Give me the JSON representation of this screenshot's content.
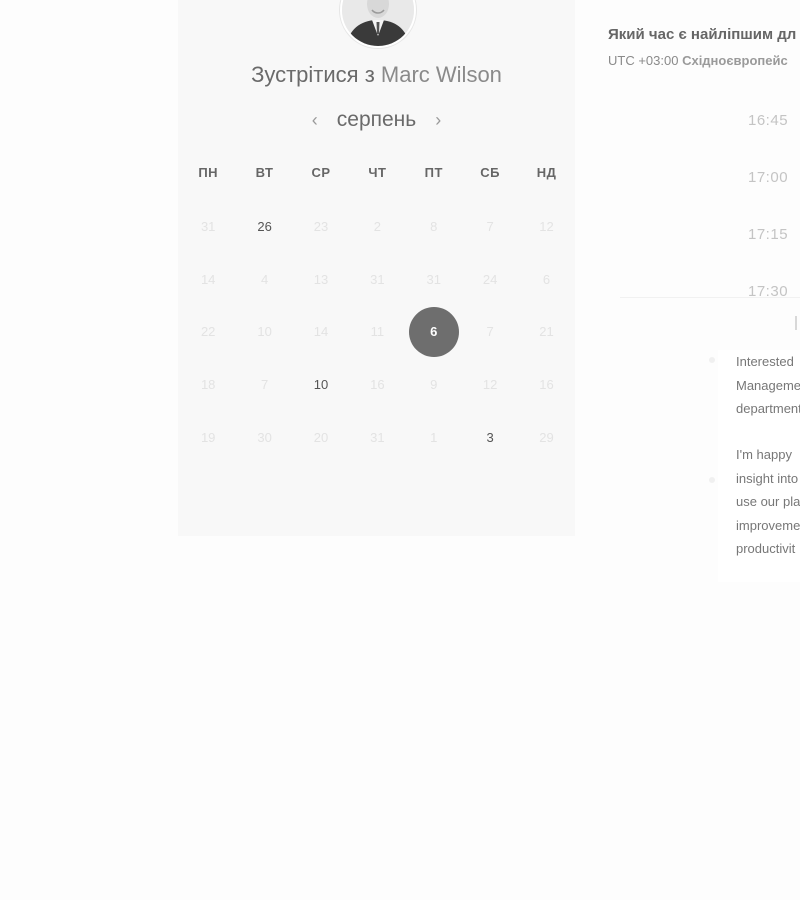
{
  "host": {
    "meet_prefix": "Зустрітися з",
    "name": "Marc Wilson"
  },
  "calendar": {
    "month": "серпень",
    "prev_icon": "chevron-left-icon",
    "next_icon": "chevron-right-icon",
    "weekdays": [
      "ПН",
      "ВТ",
      "СР",
      "ЧТ",
      "ПТ",
      "СБ",
      "НД"
    ],
    "weeks": [
      [
        "31",
        "26",
        "23",
        "2",
        "8",
        "7",
        "12"
      ],
      [
        "14",
        "4",
        "13",
        "31",
        "31",
        "24",
        "6"
      ],
      [
        "22",
        "10",
        "14",
        "11",
        "6",
        "7",
        "21"
      ],
      [
        "18",
        "7",
        "10",
        "16",
        "9",
        "12",
        "16"
      ],
      [
        "19",
        "30",
        "20",
        "31",
        "1",
        "3",
        "29"
      ]
    ],
    "available": [
      [
        0,
        1
      ],
      [
        3,
        2
      ],
      [
        4,
        5
      ]
    ],
    "selected": [
      2,
      4
    ]
  },
  "schedule": {
    "title": "Який час є найліпшим дл",
    "timezone_offset": "UTC +03:00",
    "timezone_name": "Східноєвропейс",
    "slots": [
      "16:45",
      "17:00",
      "17:15",
      "17:30"
    ]
  },
  "description": {
    "paragraph1": [
      "Interested",
      "Manageme",
      "department"
    ],
    "paragraph2": [
      "I'm happy",
      "insight into",
      "use our pla",
      "improveme",
      "productivit"
    ]
  }
}
